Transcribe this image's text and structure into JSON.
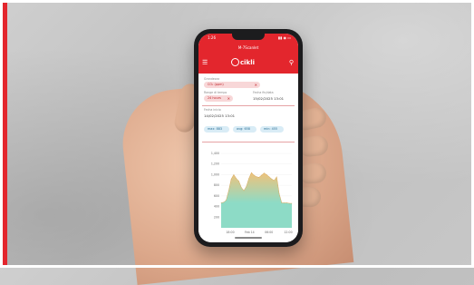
{
  "status_bar": {
    "time": "1:26",
    "indicators": "▮▮ ◉ ▭"
  },
  "title_bar": {
    "title": "M-7Scanlet"
  },
  "header": {
    "menu_icon": "menu-icon",
    "logo_text": "cikli",
    "user_icon": "user-icon"
  },
  "form": {
    "measurement_label": "Grandezza",
    "measurement_value": "CO₂ (ppm)",
    "range_label": "Range di tempo",
    "range_value": "24 hours",
    "end_label": "Fecha fin/data",
    "end_value": "15/02/2025 13:01",
    "start_label": "Fecha inicio",
    "start_value": "14/02/2025 13:01"
  },
  "stats": [
    {
      "label": "max: 883"
    },
    {
      "label": "avg: 658"
    },
    {
      "label": "min: 455"
    }
  ],
  "colors": {
    "brand": "#e3262d",
    "chip_red": "#f8d7d8",
    "chip_blue": "#d9ecf6",
    "area_top": "#f0c27a",
    "area_bottom": "#8ddbc6"
  },
  "chart_data": {
    "type": "area",
    "yticks": [
      "1,400",
      "1,200",
      "1,000",
      "800",
      "600",
      "400",
      "200"
    ],
    "xticks": [
      "18:00",
      "Feb 14",
      "06:00",
      "12:00"
    ],
    "ylim": [
      0,
      1400
    ],
    "x": [
      0,
      1,
      2,
      3,
      4,
      5,
      6,
      7,
      8,
      9,
      10,
      11,
      12,
      13,
      14,
      15,
      16,
      17,
      18,
      19,
      20,
      21,
      22,
      23,
      24,
      25,
      26,
      27,
      28
    ],
    "values": [
      470,
      480,
      520,
      700,
      920,
      1000,
      930,
      880,
      760,
      700,
      780,
      930,
      1040,
      990,
      960,
      950,
      990,
      1030,
      1000,
      960,
      920,
      890,
      960,
      640,
      470,
      470,
      470,
      460,
      460
    ],
    "grid": true
  }
}
